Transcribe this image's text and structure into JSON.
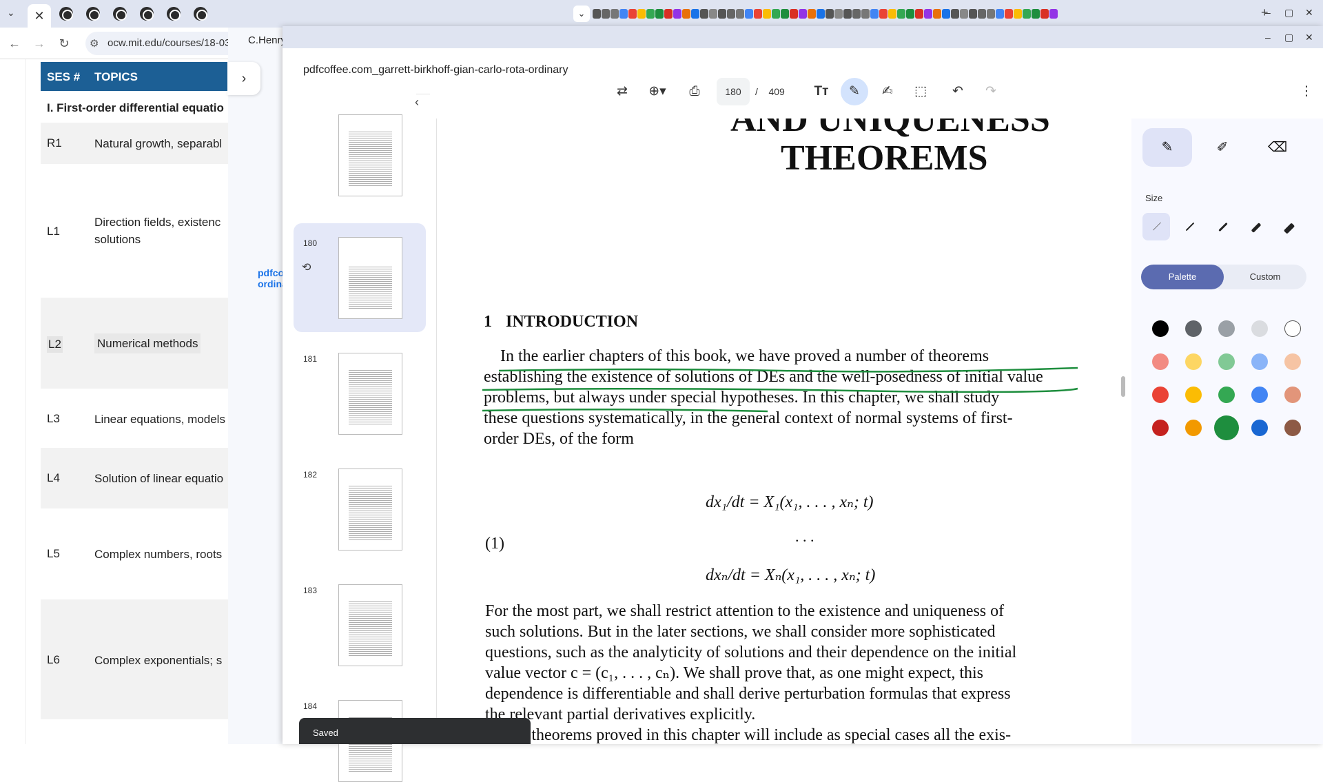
{
  "left_window": {
    "url": "ocw.mit.edu/courses/18-03",
    "active_tab_close": "✕",
    "table": {
      "header_ses": "SES #",
      "header_topics": "TOPICS",
      "section": "I. First-order differential equatio",
      "rows": [
        {
          "ses": "R1",
          "topic": "Natural growth, separabl"
        },
        {
          "ses": "L1",
          "topic": "Direction fields, existenc",
          "topic2": "solutions"
        },
        {
          "ses": "L2",
          "topic": "Numerical methods"
        },
        {
          "ses": "L3",
          "topic": "Linear equations, models"
        },
        {
          "ses": "L4",
          "topic": "Solution of linear equatio"
        },
        {
          "ses": "L5",
          "topic": "Complex numbers, roots"
        },
        {
          "ses": "L6",
          "topic": "Complex exponentials; s"
        }
      ]
    },
    "partial_text": "C.Henry",
    "partial_link_1": "pdfco",
    "partial_link_2": "ordina"
  },
  "viewer": {
    "filename": "pdfcoffee.com_garrett-birkhoff-gian-carlo-rota-ordinary",
    "page_current": "180",
    "page_total": "409",
    "page_sep": "/",
    "thumbnails": [
      {
        "num": "",
        "top": 0
      },
      {
        "num": "180"
      },
      {
        "num": "181"
      },
      {
        "num": "182"
      },
      {
        "num": "183"
      },
      {
        "num": "184"
      }
    ],
    "page": {
      "heading1": "AND UNIQUENESS",
      "heading2": "THEOREMS",
      "section_num": "1",
      "section_title": "INTRODUCTION",
      "para1": [
        "In the earlier chapters of this book, we have proved a number of theorems",
        "establishing the existence of solutions of DEs and the well-posedness of initial value",
        "problems, but always under special hypotheses. In this chapter, we shall study",
        "these questions systematically, in the general context of normal systems of first-",
        "order DEs, of the form"
      ],
      "eq_label": "(1)",
      "eq1": "dx₁/dt = X₁(x₁, . . . , xₙ; t)",
      "eq_dots": ". . .",
      "eq2": "dxₙ/dt = Xₙ(x₁, . . . , xₙ; t)",
      "para2": [
        "For the most part, we shall restrict attention to the existence and uniqueness of",
        "such solutions. But in the later sections, we shall consider more sophisticated",
        "questions, such as the analyticity of solutions and their dependence on the initial",
        "value vector c = (c₁, . . . , cₙ). We shall prove that, as one might expect, this",
        "dependence is differentiable and shall derive perturbation formulas that express",
        "the relevant partial derivatives explicitly.",
        "The theorems proved in this chapter will include as special cases all the exis-"
      ]
    },
    "annotation": {
      "size_label": "Size",
      "tab_palette": "Palette",
      "tab_custom": "Custom",
      "colors": [
        [
          "#000000",
          "#5f6368",
          "#9aa0a6",
          "#dadce0",
          "#ffffff"
        ],
        [
          "#f28b82",
          "#fdd663",
          "#81c995",
          "#8ab4f8",
          "#f6c4a4"
        ],
        [
          "#ea4335",
          "#fbbc04",
          "#34a853",
          "#4285f4",
          "#e2957a"
        ],
        [
          "#c5221f",
          "#f29900",
          "#1e8e3e",
          "#1967d2",
          "#8d5a45"
        ]
      ],
      "selected_color": "#1e8e3e"
    },
    "toast": "Saved"
  }
}
